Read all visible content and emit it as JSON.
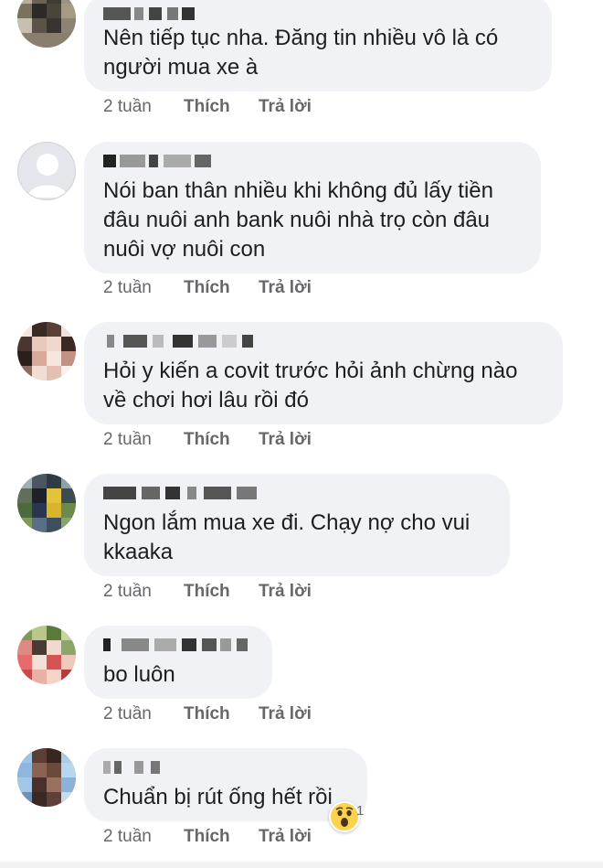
{
  "colors": {
    "bubble": "#f0f2f5",
    "text": "#1c1e21",
    "meta": "#65676b",
    "reaction": "#fcd34d"
  },
  "comments": [
    {
      "text": "Nên tiếp tục nha.  Đăng tin nhiều vô là có\nngười mua xe à",
      "time": "2 tuần",
      "like": "Thích",
      "reply": "Trả lời",
      "avatar": "pixelated-avatar"
    },
    {
      "text": "Nói ban thân nhiều khi không đủ lấy tiền\nđâu nuôi anh bank nuôi nhà trọ còn đâu\nnuôi vợ nuôi con",
      "time": "2 tuần",
      "like": "Thích",
      "reply": "Trả lời",
      "avatar": "default-avatar"
    },
    {
      "text": "Hỏi y kiến a covit trước hỏi ảnh chừng nào\nvề chơi hơi lâu rồi đó",
      "time": "2 tuần",
      "like": "Thích",
      "reply": "Trả lời",
      "avatar": "pixelated-avatar"
    },
    {
      "text": "Ngon lắm mua xe đi. Chạy nợ cho vui\nkkaaka",
      "time": "2 tuần",
      "like": "Thích",
      "reply": "Trả lời",
      "avatar": "pixelated-avatar"
    },
    {
      "text": "bo luôn",
      "time": "2 tuần",
      "like": "Thích",
      "reply": "Trả lời",
      "avatar": "pixelated-avatar"
    },
    {
      "text": "Chuẩn bị rút ống hết rồi",
      "time": "2 tuần",
      "like": "Thích",
      "reply": "Trả lời",
      "avatar": "pixelated-avatar",
      "reaction": {
        "icon": "wow-reaction-icon",
        "count": "1"
      }
    }
  ]
}
